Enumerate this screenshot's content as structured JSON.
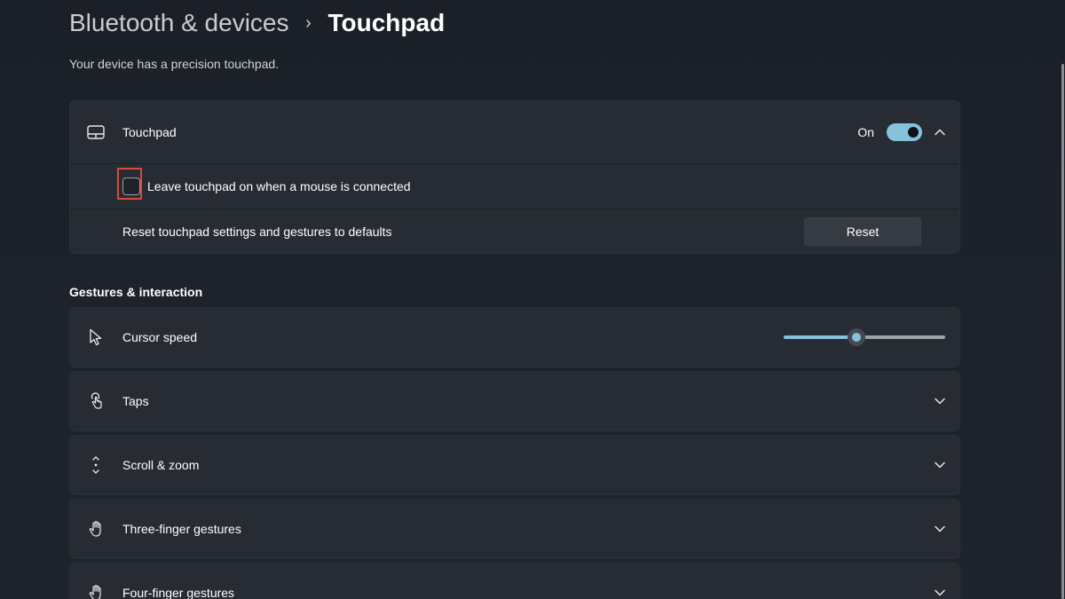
{
  "breadcrumb": {
    "parent": "Bluetooth & devices",
    "separator": "›",
    "current": "Touchpad"
  },
  "subtitle": "Your device has a precision touchpad.",
  "touchpad_card": {
    "label": "Touchpad",
    "icon": "touchpad-icon",
    "toggle_state_text": "On",
    "toggle_on": true,
    "expanded": true,
    "leave_on_checkbox": {
      "label": "Leave touchpad on when a mouse is connected",
      "checked": false
    },
    "reset_row": {
      "label": "Reset touchpad settings and gestures to defaults",
      "button_label": "Reset"
    }
  },
  "gestures_section": {
    "title": "Gestures & interaction",
    "items": [
      {
        "label": "Cursor speed",
        "icon": "cursor-icon",
        "control": "slider"
      },
      {
        "label": "Taps",
        "icon": "tap-icon",
        "control": "expander"
      },
      {
        "label": "Scroll & zoom",
        "icon": "scroll-icon",
        "control": "expander"
      },
      {
        "label": "Three-finger gestures",
        "icon": "hand-icon",
        "control": "expander"
      },
      {
        "label": "Four-finger gestures",
        "icon": "hand-icon",
        "control": "expander"
      }
    ]
  },
  "cursor_speed_level": 0.45,
  "colors": {
    "accent": "#85c3dd",
    "background": "#1d222b",
    "card": "#272b33",
    "highlight": "#e0463a"
  }
}
